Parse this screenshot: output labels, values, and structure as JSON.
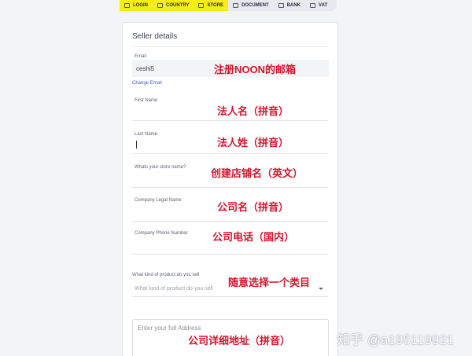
{
  "steps": [
    {
      "label": "LOGIN",
      "icon": "login-icon"
    },
    {
      "label": "COUNTRY",
      "icon": "country-icon"
    },
    {
      "label": "STORE",
      "icon": "store-icon"
    },
    {
      "label": "DOCUMENT",
      "icon": "document-icon"
    },
    {
      "label": "BANK",
      "icon": "bank-icon"
    },
    {
      "label": "VAT",
      "icon": "vat-icon"
    }
  ],
  "form": {
    "title": "Seller details",
    "email_label": "Email",
    "email_value": "ceshi5",
    "change_email": "Change Email",
    "first_name_label": "First Name",
    "last_name_label": "Last Name",
    "store_name_label": "Whats your store name?",
    "company_legal_label": "Company Legal Name",
    "company_phone_label": "Company Phone Number",
    "product_label": "What kind of product do you sell",
    "product_placeholder": "What kind of product do you sell",
    "address_placeholder": "Enter your full Address"
  },
  "annotations": {
    "email": "注册NOON的邮箱",
    "first_name": "法人名（拼音）",
    "last_name": "法人姓（拼音）",
    "store_name": "创建店铺名（英文）",
    "company_name": "公司名（拼音）",
    "company_phone": "公司电话（国内）",
    "product": "随意选择一个类目",
    "address": "公司详细地址（拼音）"
  },
  "watermark": "知乎 @a195119921",
  "colors": {
    "step_done": "#f7ec13",
    "annotation": "#d8142c",
    "link": "#3d5bd6"
  }
}
